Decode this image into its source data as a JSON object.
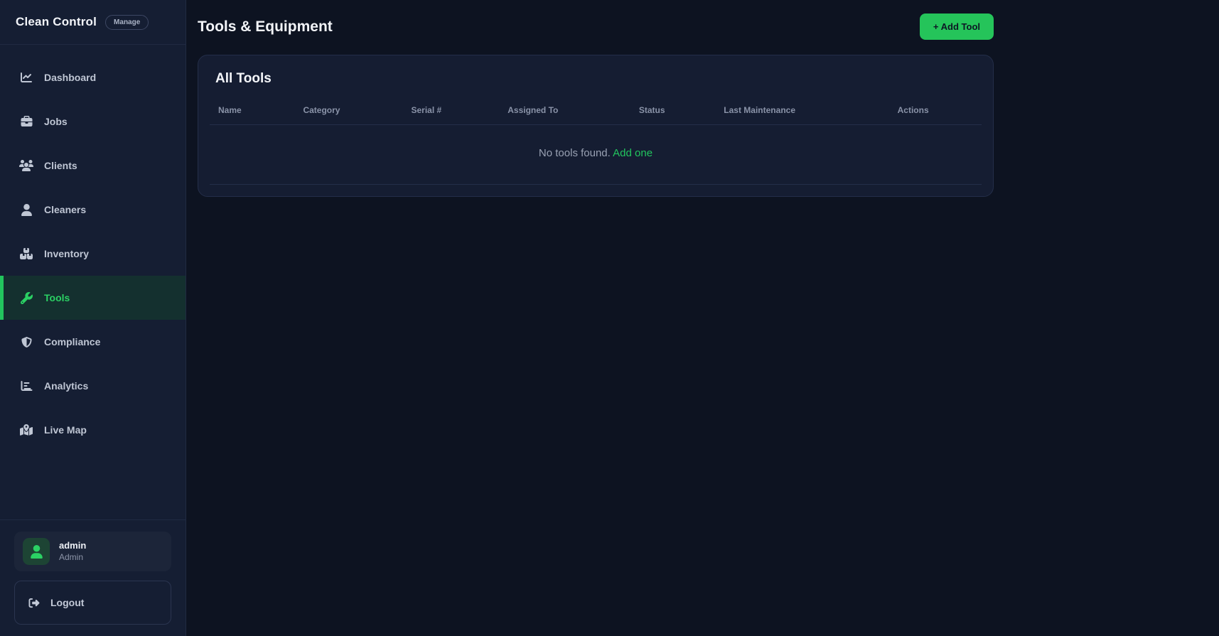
{
  "app": {
    "name": "Clean Control",
    "badge": "Manage"
  },
  "sidebar": {
    "items": [
      {
        "label": "Dashboard",
        "icon": "chart-line-icon",
        "active": false
      },
      {
        "label": "Jobs",
        "icon": "briefcase-icon",
        "active": false
      },
      {
        "label": "Clients",
        "icon": "users-icon",
        "active": false
      },
      {
        "label": "Cleaners",
        "icon": "user-icon",
        "active": false
      },
      {
        "label": "Inventory",
        "icon": "boxes-icon",
        "active": false
      },
      {
        "label": "Tools",
        "icon": "wrench-icon",
        "active": true
      },
      {
        "label": "Compliance",
        "icon": "shield-icon",
        "active": false
      },
      {
        "label": "Analytics",
        "icon": "bar-chart-icon",
        "active": false
      },
      {
        "label": "Live Map",
        "icon": "map-icon",
        "active": false
      }
    ],
    "user": {
      "name": "admin",
      "role": "Admin"
    },
    "logout_label": "Logout"
  },
  "header": {
    "title": "Tools & Equipment",
    "add_button_label": "+ Add Tool"
  },
  "main": {
    "card_title": "All Tools",
    "table": {
      "columns": [
        "Name",
        "Category",
        "Serial #",
        "Assigned To",
        "Status",
        "Last Maintenance",
        "Actions"
      ],
      "rows": [],
      "empty_text": "No tools found.",
      "empty_link_label": "Add one"
    }
  },
  "colors": {
    "accent_green": "#22c55e",
    "button_green": "#25c45a",
    "page_background": "#0d1321",
    "sidebar_background": "#151e33",
    "card_background": "#151d32",
    "active_item_background": "#14302f"
  }
}
